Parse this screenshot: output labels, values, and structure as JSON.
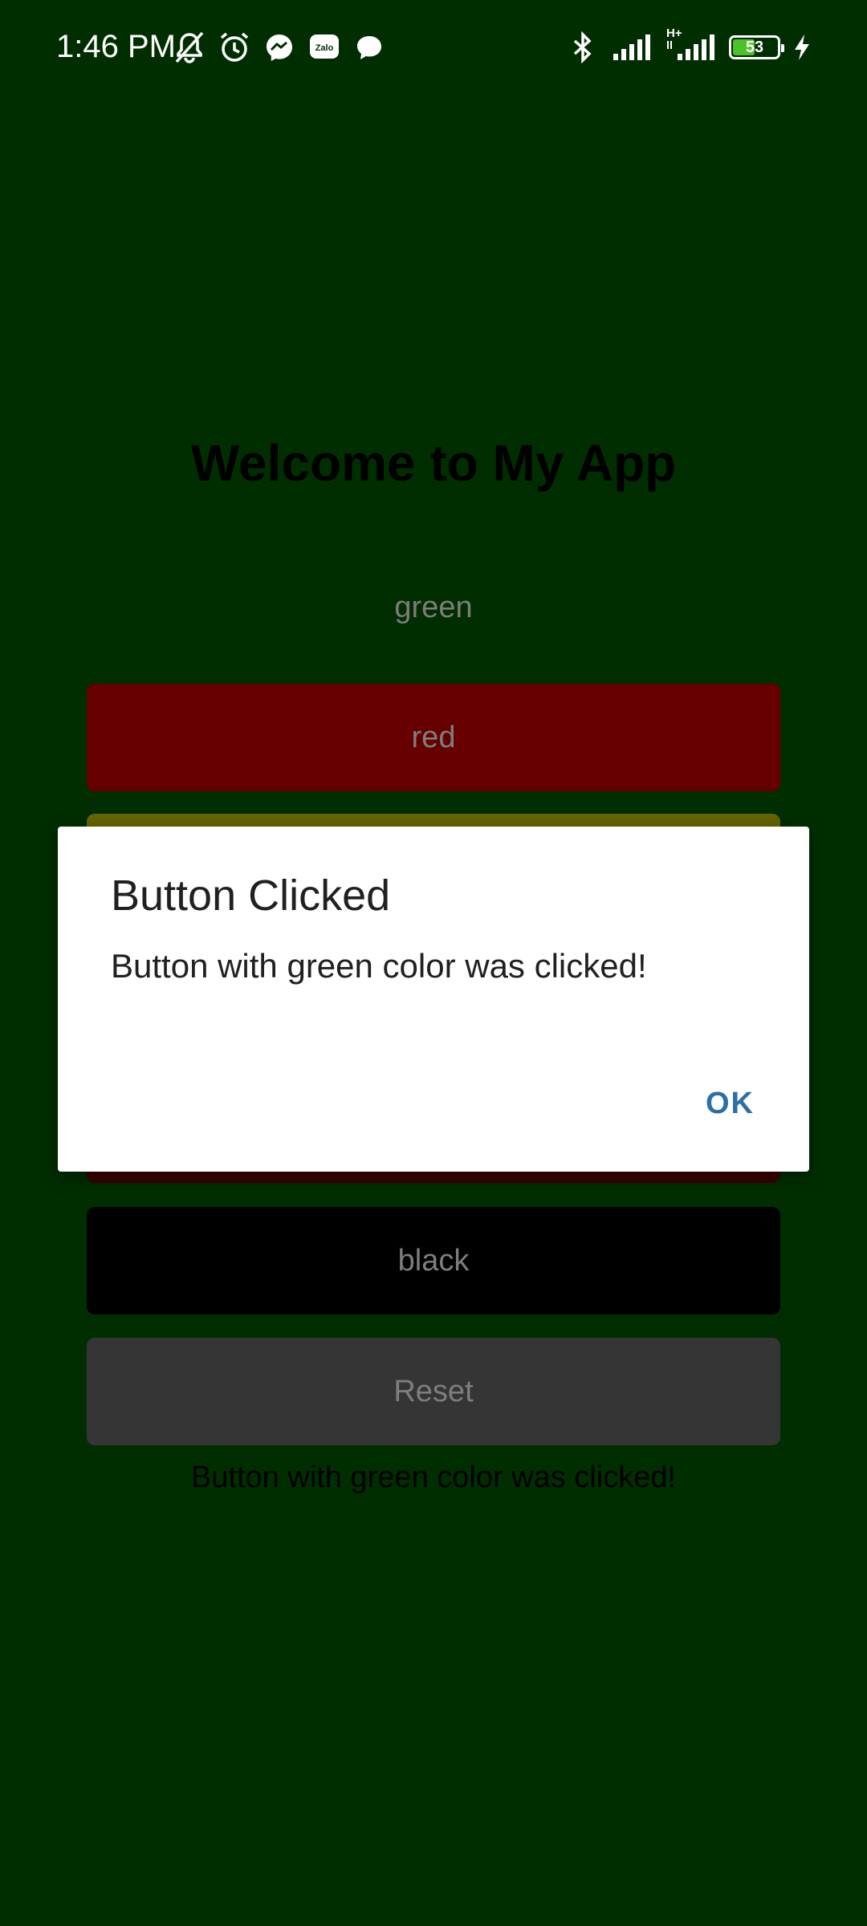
{
  "status_bar": {
    "time": "1:46 PM",
    "battery_level": "53",
    "battery_percent": 53,
    "network_label": "H+",
    "icons_left": [
      "muted-bell-icon",
      "alarm-icon",
      "messenger-icon",
      "zalo-icon",
      "chat-bubble-icon"
    ],
    "icons_right": [
      "bluetooth-icon",
      "signal-icon",
      "signal-hplus-icon",
      "battery-icon",
      "charging-icon"
    ]
  },
  "app": {
    "title": "Welcome to My App",
    "current_color_label": "green",
    "buttons": {
      "red": "red",
      "black": "black",
      "reset": "Reset"
    },
    "status_message": "Button with green color was clicked!"
  },
  "dialog": {
    "title": "Button Clicked",
    "message": "Button with green color was clicked!",
    "ok_label": "OK"
  },
  "colors": {
    "background": "#002e00",
    "red_button": "#660000",
    "yellow_button": "#666600",
    "black_button": "#000000",
    "reset_button": "#353535",
    "dialog_accent": "#2a6fa8"
  }
}
